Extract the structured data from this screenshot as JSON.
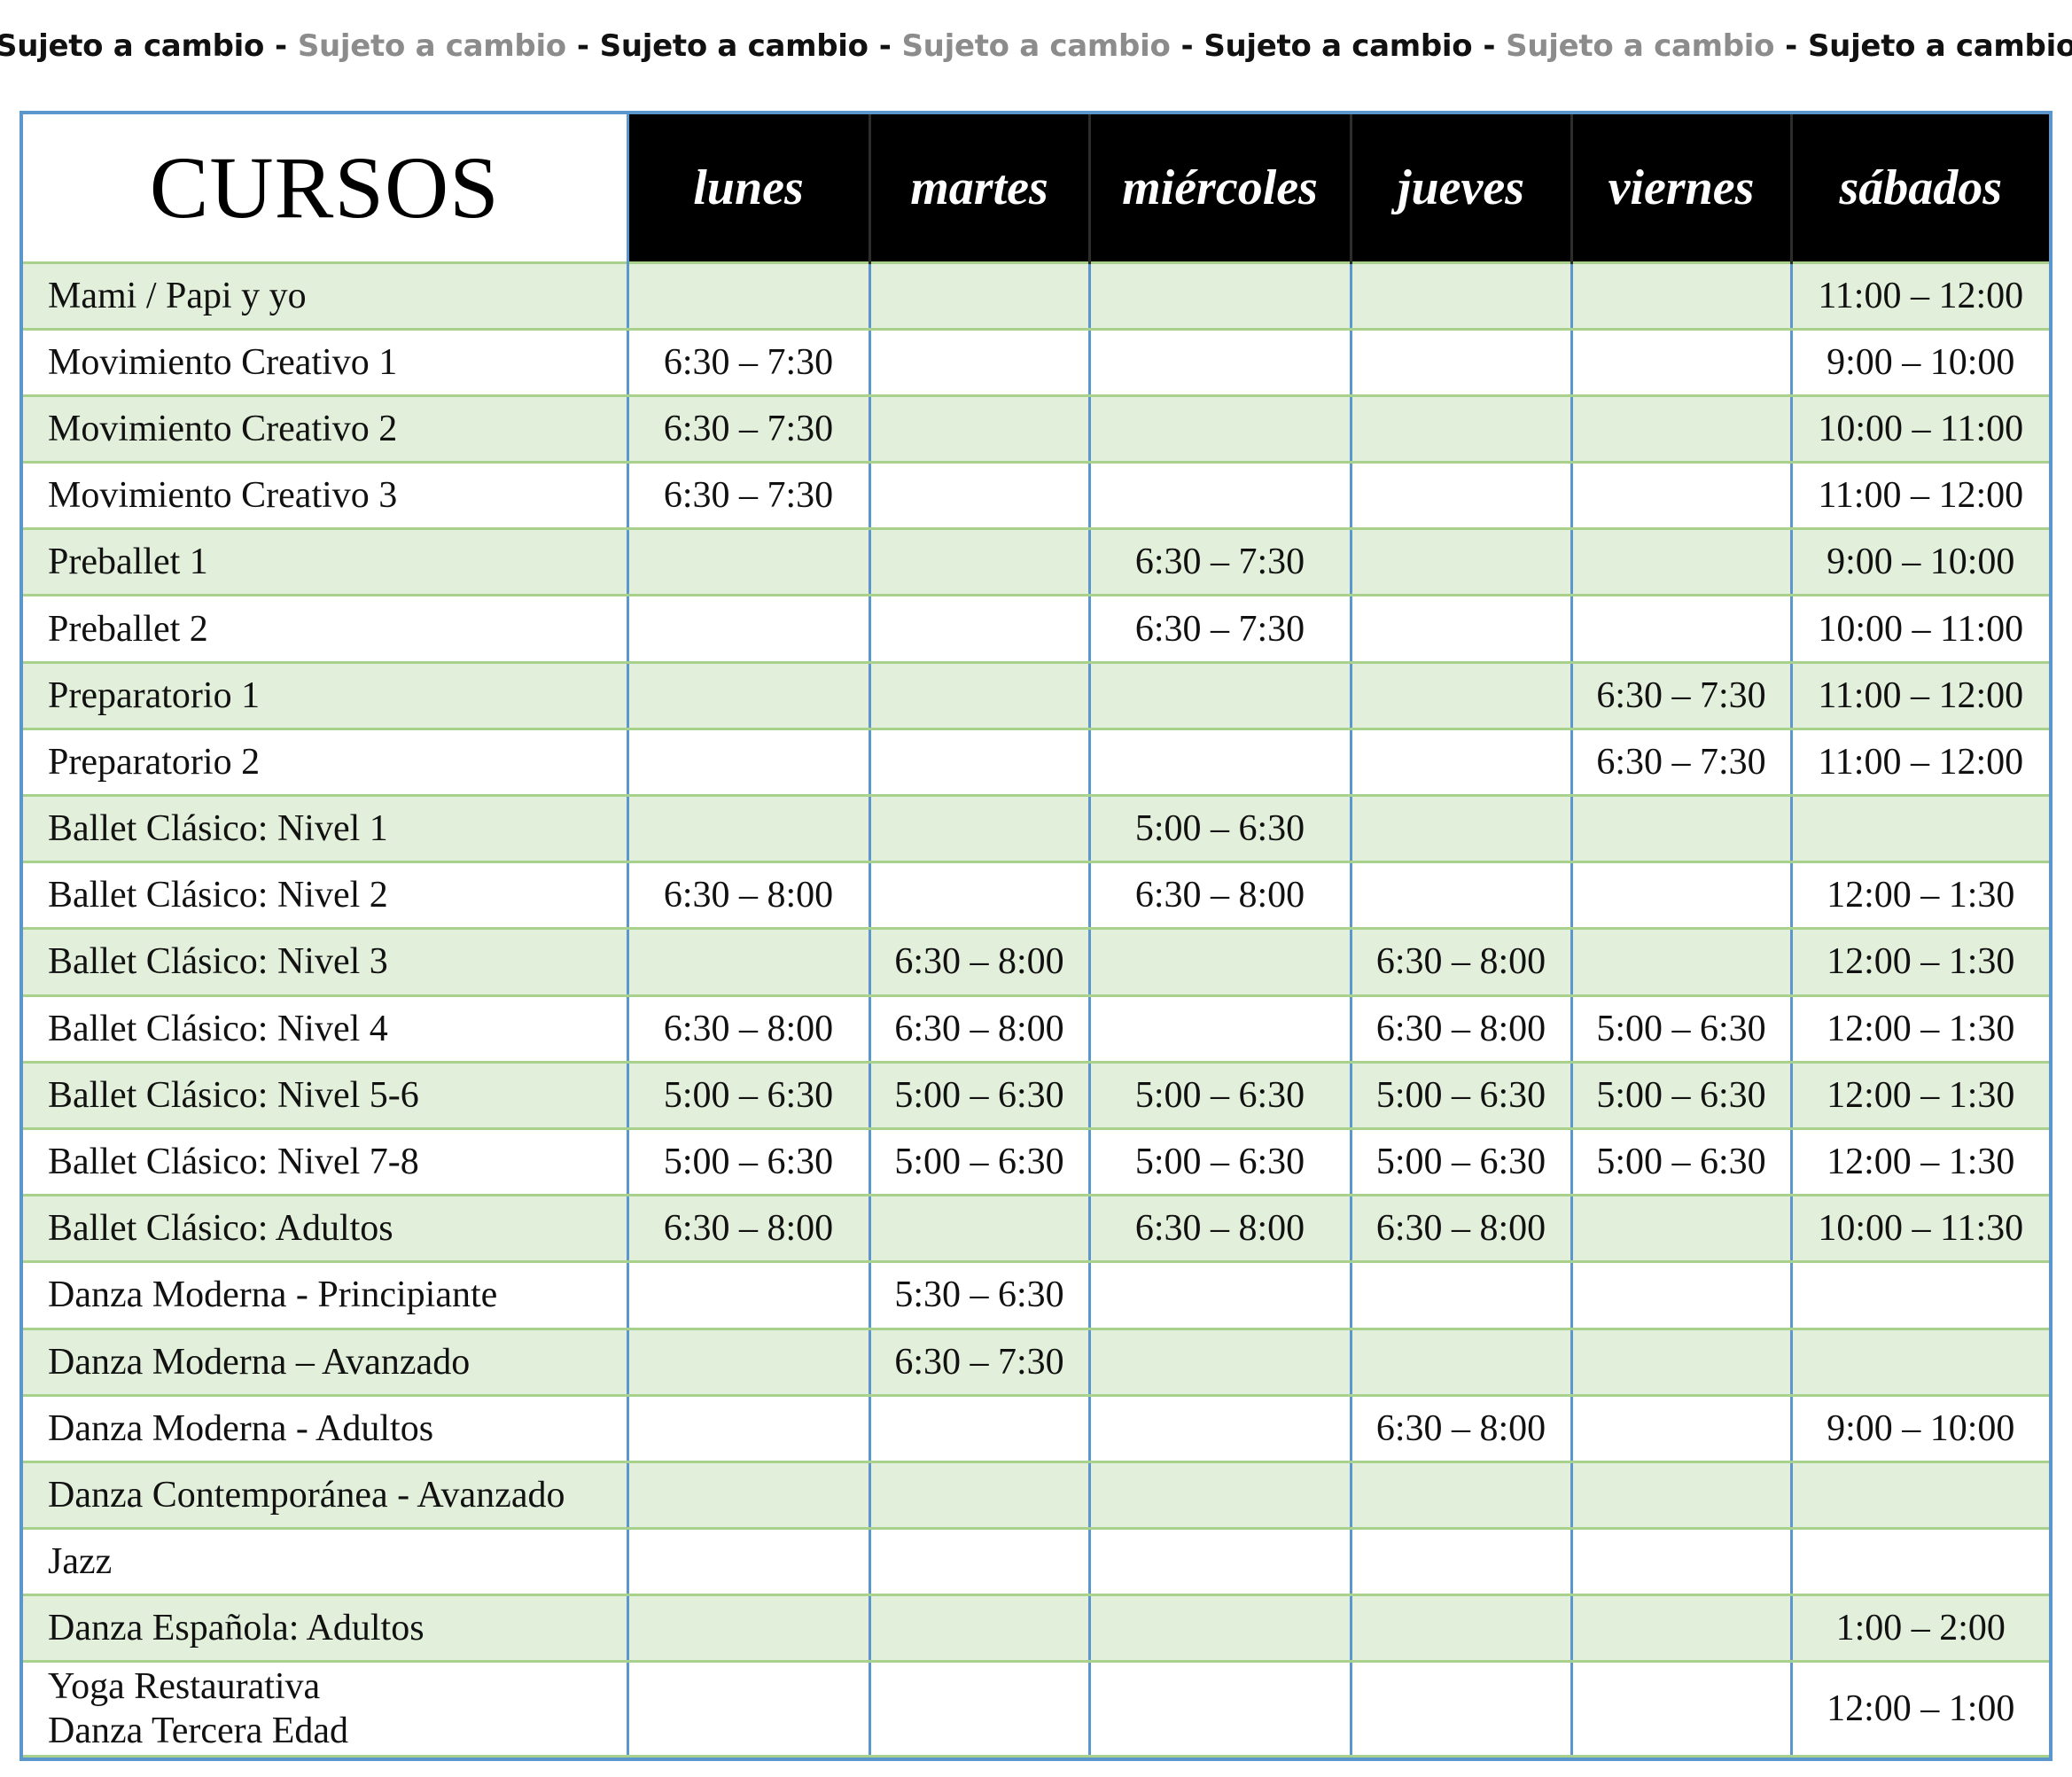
{
  "banner": [
    "Sujeto a cambio",
    "Sujeto a cambio",
    "Sujeto a cambio",
    "Sujeto a cambio",
    "Sujeto a cambio",
    "Sujeto a cambio",
    "Sujeto a cambio"
  ],
  "banner_separator": "-",
  "table": {
    "header": {
      "cursos": "CURSOS",
      "days": [
        "lunes",
        "martes",
        "miércoles",
        "jueves",
        "viernes",
        "sábados"
      ]
    },
    "rows": [
      {
        "course": "Mami / Papi y yo",
        "times": [
          "",
          "",
          "",
          "",
          "",
          "11:00 – 12:00"
        ]
      },
      {
        "course": "Movimiento Creativo 1",
        "times": [
          "6:30 – 7:30",
          "",
          "",
          "",
          "",
          "9:00 – 10:00"
        ]
      },
      {
        "course": "Movimiento Creativo 2",
        "times": [
          "6:30 – 7:30",
          "",
          "",
          "",
          "",
          "10:00 – 11:00"
        ]
      },
      {
        "course": "Movimiento Creativo 3",
        "times": [
          "6:30 – 7:30",
          "",
          "",
          "",
          "",
          "11:00 – 12:00"
        ]
      },
      {
        "course": "Preballet 1",
        "times": [
          "",
          "",
          "6:30 – 7:30",
          "",
          "",
          "9:00 – 10:00"
        ]
      },
      {
        "course": "Preballet 2",
        "times": [
          "",
          "",
          "6:30 – 7:30",
          "",
          "",
          "10:00 – 11:00"
        ]
      },
      {
        "course": "Preparatorio 1",
        "times": [
          "",
          "",
          "",
          "",
          "6:30 – 7:30",
          "11:00 – 12:00"
        ]
      },
      {
        "course": "Preparatorio 2",
        "times": [
          "",
          "",
          "",
          "",
          "6:30 – 7:30",
          "11:00 – 12:00"
        ]
      },
      {
        "course": "Ballet Clásico: Nivel 1",
        "times": [
          "",
          "",
          "5:00 – 6:30",
          "",
          "",
          ""
        ]
      },
      {
        "course": "Ballet Clásico: Nivel 2",
        "times": [
          "6:30 – 8:00",
          "",
          "6:30 – 8:00",
          "",
          "",
          "12:00 – 1:30"
        ]
      },
      {
        "course": "Ballet Clásico: Nivel 3",
        "times": [
          "",
          "6:30 – 8:00",
          "",
          "6:30 – 8:00",
          "",
          "12:00 – 1:30"
        ]
      },
      {
        "course": "Ballet Clásico: Nivel 4",
        "times": [
          "6:30 – 8:00",
          "6:30 – 8:00",
          "",
          "6:30 – 8:00",
          "5:00 – 6:30",
          "12:00 – 1:30"
        ]
      },
      {
        "course": "Ballet Clásico: Nivel 5-6",
        "times": [
          "5:00 – 6:30",
          "5:00 – 6:30",
          "5:00 – 6:30",
          "5:00 – 6:30",
          "5:00 – 6:30",
          "12:00 – 1:30"
        ]
      },
      {
        "course": "Ballet Clásico: Nivel 7-8",
        "times": [
          "5:00 – 6:30",
          "5:00 – 6:30",
          "5:00 – 6:30",
          "5:00 – 6:30",
          "5:00 – 6:30",
          "12:00 – 1:30"
        ]
      },
      {
        "course": "Ballet Clásico: Adultos",
        "times": [
          "6:30 – 8:00",
          "",
          "6:30 – 8:00",
          "6:30 – 8:00",
          "",
          "10:00 – 11:30"
        ]
      },
      {
        "course": "Danza Moderna - Principiante",
        "times": [
          "",
          "5:30 – 6:30",
          "",
          "",
          "",
          ""
        ]
      },
      {
        "course": "Danza Moderna – Avanzado",
        "times": [
          "",
          "6:30 – 7:30",
          "",
          "",
          "",
          ""
        ]
      },
      {
        "course": "Danza Moderna - Adultos",
        "times": [
          "",
          "",
          "",
          "6:30 – 8:00",
          "",
          "9:00 – 10:00"
        ]
      },
      {
        "course": "Danza Contemporánea - Avanzado",
        "times": [
          "",
          "",
          "",
          "",
          "",
          ""
        ]
      },
      {
        "course": "Jazz",
        "times": [
          "",
          "",
          "",
          "",
          "",
          ""
        ]
      },
      {
        "course": "Danza Española: Adultos",
        "times": [
          "",
          "",
          "",
          "",
          "",
          "1:00 – 2:00"
        ]
      },
      {
        "course_lines": [
          "Yoga Restaurativa",
          "Danza Tercera Edad"
        ],
        "times": [
          "",
          "",
          "",
          "",
          "",
          "12:00 – 1:00"
        ]
      }
    ]
  },
  "colors": {
    "border_blue": "#5b96cc",
    "row_shade_green": "#e2efda",
    "row_line_green": "#a9d18e",
    "header_black": "#000000",
    "banner_grey": "#8c8c8c"
  }
}
